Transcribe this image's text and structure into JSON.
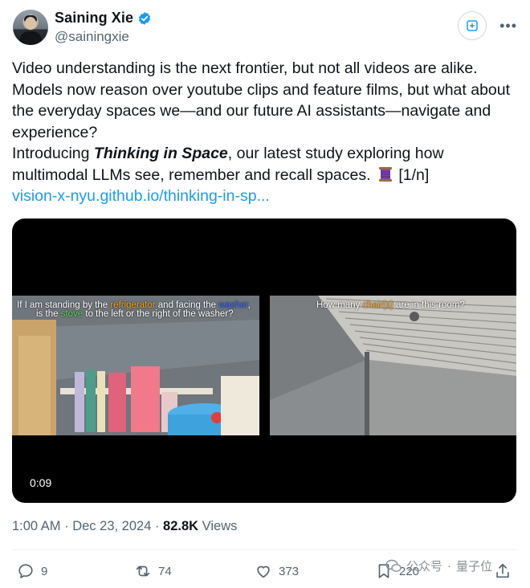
{
  "author": {
    "name": "Saining Xie",
    "handle": "@sainingxie"
  },
  "tweet": {
    "line1": "Video understanding is the next frontier, but not all videos are alike. Models now reason over youtube clips and feature films, but what about the everyday spaces we—and our future AI assistants—navigate and experience?",
    "intro_prefix": "Introducing ",
    "intro_bold": "Thinking in Space",
    "intro_suffix": ", our latest study exploring how multimodal LLMs see, remember and recall spaces.",
    "thread_marker": "[1/n]",
    "link": "vision-x-nyu.github.io/thinking-in-sp..."
  },
  "media": {
    "left_caption": {
      "p1": "If I am standing by the ",
      "w1": "refrigerator",
      "p2": " and facing the ",
      "w2": "washer",
      "p3": ",",
      "p4": "is the ",
      "w3": "stove",
      "p5": " to the left or the right of the washer?"
    },
    "right_caption": {
      "p1": "How many ",
      "w1": "chair(s)",
      "p2": " are in this room?"
    },
    "duration": "0:09"
  },
  "meta": {
    "time": "1:00 AM",
    "sep": " · ",
    "date": "Dec 23, 2024",
    "views_count": "82.8K",
    "views_label": "Views"
  },
  "actions": {
    "replies": "9",
    "reposts": "74",
    "likes": "373",
    "bookmarks": "220"
  },
  "watermark": {
    "platform": "公众号",
    "dot": "·",
    "name": "量子位"
  },
  "colors": {
    "link": "#1d9bf0",
    "verified": "#1d9bf0",
    "muted": "#536471"
  }
}
